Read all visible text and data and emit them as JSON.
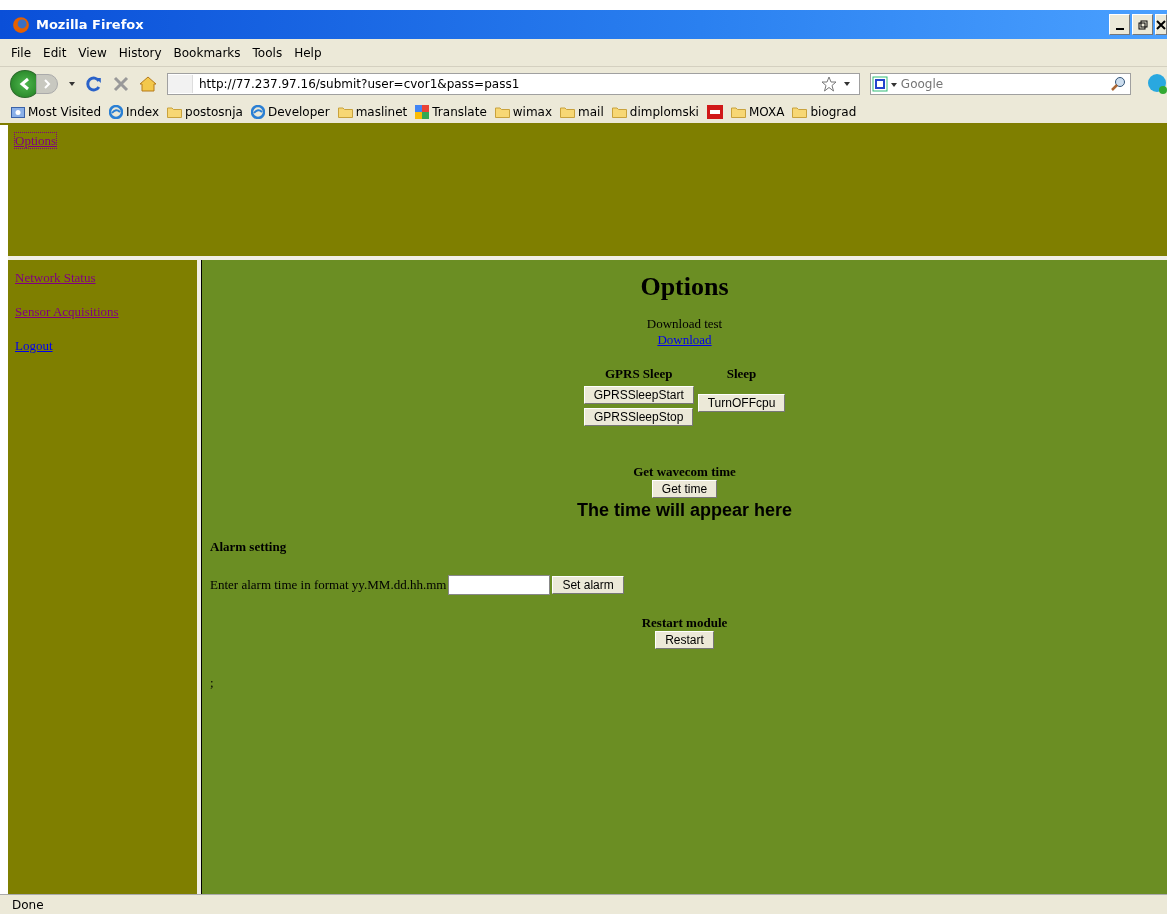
{
  "window": {
    "title": "Mozilla Firefox"
  },
  "menu": [
    "File",
    "Edit",
    "View",
    "History",
    "Bookmarks",
    "Tools",
    "Help"
  ],
  "address": {
    "value": "http://77.237.97.16/submit?user=cvor1&pass=pass1"
  },
  "search": {
    "placeholder": "Google"
  },
  "bookmarks": [
    {
      "label": "Most Visited",
      "kind": "smart"
    },
    {
      "label": "Index",
      "kind": "web"
    },
    {
      "label": "postosnja",
      "kind": "folder"
    },
    {
      "label": "Developer",
      "kind": "web"
    },
    {
      "label": "maslinet",
      "kind": "folder"
    },
    {
      "label": "Translate",
      "kind": "translate"
    },
    {
      "label": "wimax",
      "kind": "folder"
    },
    {
      "label": "mail",
      "kind": "folder"
    },
    {
      "label": "dimplomski",
      "kind": "folder"
    },
    {
      "kind": "badge"
    },
    {
      "label": "MOXA",
      "kind": "folder"
    },
    {
      "label": "biograd",
      "kind": "folder"
    }
  ],
  "top_frame": {
    "link": {
      "label": "Options",
      "visited": true,
      "focused": true
    }
  },
  "sidebar": {
    "items": [
      {
        "label": "Network Status",
        "visited": true
      },
      {
        "label": "Sensor Acquisitions",
        "visited": true
      },
      {
        "label": "Logout",
        "visited": false
      }
    ]
  },
  "main": {
    "heading": "Options",
    "download_text": "Download test",
    "download_link": "Download",
    "gprs": {
      "title": "GPRS Sleep",
      "buttons": [
        "GPRSSleepStart",
        "GPRSSleepStop"
      ]
    },
    "sleep": {
      "title": "Sleep",
      "button": "TurnOFFcpu"
    },
    "time": {
      "title": "Get wavecom time",
      "button": "Get time",
      "result": "The time will appear here"
    },
    "alarm": {
      "title": "Alarm setting",
      "label": "Enter alarm time in format yy.MM.dd.hh.mm",
      "button": "Set alarm"
    },
    "restart": {
      "title": "Restart module",
      "button": "Restart"
    },
    "footer_text": ";"
  },
  "status_bar": {
    "text": "Done"
  }
}
